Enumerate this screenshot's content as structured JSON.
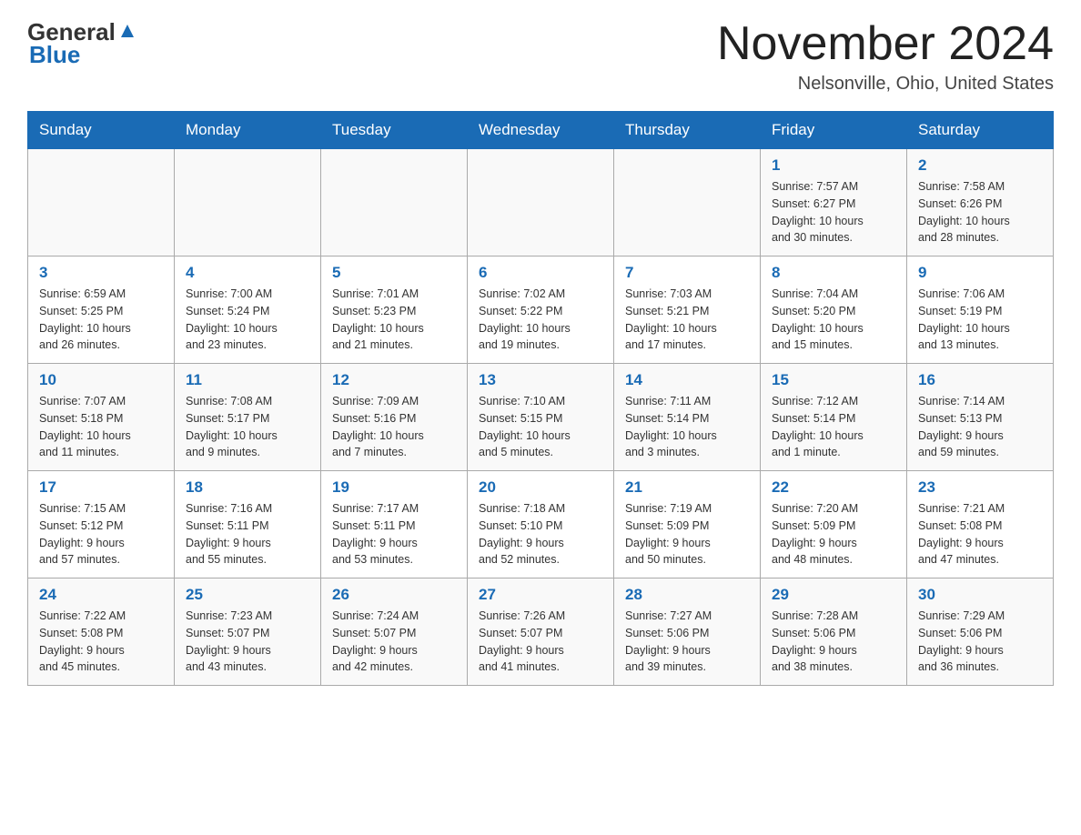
{
  "header": {
    "logo_general": "General",
    "logo_blue": "Blue",
    "month_title": "November 2024",
    "location": "Nelsonville, Ohio, United States"
  },
  "weekdays": [
    "Sunday",
    "Monday",
    "Tuesday",
    "Wednesday",
    "Thursday",
    "Friday",
    "Saturday"
  ],
  "weeks": [
    [
      {
        "day": "",
        "info": ""
      },
      {
        "day": "",
        "info": ""
      },
      {
        "day": "",
        "info": ""
      },
      {
        "day": "",
        "info": ""
      },
      {
        "day": "",
        "info": ""
      },
      {
        "day": "1",
        "info": "Sunrise: 7:57 AM\nSunset: 6:27 PM\nDaylight: 10 hours\nand 30 minutes."
      },
      {
        "day": "2",
        "info": "Sunrise: 7:58 AM\nSunset: 6:26 PM\nDaylight: 10 hours\nand 28 minutes."
      }
    ],
    [
      {
        "day": "3",
        "info": "Sunrise: 6:59 AM\nSunset: 5:25 PM\nDaylight: 10 hours\nand 26 minutes."
      },
      {
        "day": "4",
        "info": "Sunrise: 7:00 AM\nSunset: 5:24 PM\nDaylight: 10 hours\nand 23 minutes."
      },
      {
        "day": "5",
        "info": "Sunrise: 7:01 AM\nSunset: 5:23 PM\nDaylight: 10 hours\nand 21 minutes."
      },
      {
        "day": "6",
        "info": "Sunrise: 7:02 AM\nSunset: 5:22 PM\nDaylight: 10 hours\nand 19 minutes."
      },
      {
        "day": "7",
        "info": "Sunrise: 7:03 AM\nSunset: 5:21 PM\nDaylight: 10 hours\nand 17 minutes."
      },
      {
        "day": "8",
        "info": "Sunrise: 7:04 AM\nSunset: 5:20 PM\nDaylight: 10 hours\nand 15 minutes."
      },
      {
        "day": "9",
        "info": "Sunrise: 7:06 AM\nSunset: 5:19 PM\nDaylight: 10 hours\nand 13 minutes."
      }
    ],
    [
      {
        "day": "10",
        "info": "Sunrise: 7:07 AM\nSunset: 5:18 PM\nDaylight: 10 hours\nand 11 minutes."
      },
      {
        "day": "11",
        "info": "Sunrise: 7:08 AM\nSunset: 5:17 PM\nDaylight: 10 hours\nand 9 minutes."
      },
      {
        "day": "12",
        "info": "Sunrise: 7:09 AM\nSunset: 5:16 PM\nDaylight: 10 hours\nand 7 minutes."
      },
      {
        "day": "13",
        "info": "Sunrise: 7:10 AM\nSunset: 5:15 PM\nDaylight: 10 hours\nand 5 minutes."
      },
      {
        "day": "14",
        "info": "Sunrise: 7:11 AM\nSunset: 5:14 PM\nDaylight: 10 hours\nand 3 minutes."
      },
      {
        "day": "15",
        "info": "Sunrise: 7:12 AM\nSunset: 5:14 PM\nDaylight: 10 hours\nand 1 minute."
      },
      {
        "day": "16",
        "info": "Sunrise: 7:14 AM\nSunset: 5:13 PM\nDaylight: 9 hours\nand 59 minutes."
      }
    ],
    [
      {
        "day": "17",
        "info": "Sunrise: 7:15 AM\nSunset: 5:12 PM\nDaylight: 9 hours\nand 57 minutes."
      },
      {
        "day": "18",
        "info": "Sunrise: 7:16 AM\nSunset: 5:11 PM\nDaylight: 9 hours\nand 55 minutes."
      },
      {
        "day": "19",
        "info": "Sunrise: 7:17 AM\nSunset: 5:11 PM\nDaylight: 9 hours\nand 53 minutes."
      },
      {
        "day": "20",
        "info": "Sunrise: 7:18 AM\nSunset: 5:10 PM\nDaylight: 9 hours\nand 52 minutes."
      },
      {
        "day": "21",
        "info": "Sunrise: 7:19 AM\nSunset: 5:09 PM\nDaylight: 9 hours\nand 50 minutes."
      },
      {
        "day": "22",
        "info": "Sunrise: 7:20 AM\nSunset: 5:09 PM\nDaylight: 9 hours\nand 48 minutes."
      },
      {
        "day": "23",
        "info": "Sunrise: 7:21 AM\nSunset: 5:08 PM\nDaylight: 9 hours\nand 47 minutes."
      }
    ],
    [
      {
        "day": "24",
        "info": "Sunrise: 7:22 AM\nSunset: 5:08 PM\nDaylight: 9 hours\nand 45 minutes."
      },
      {
        "day": "25",
        "info": "Sunrise: 7:23 AM\nSunset: 5:07 PM\nDaylight: 9 hours\nand 43 minutes."
      },
      {
        "day": "26",
        "info": "Sunrise: 7:24 AM\nSunset: 5:07 PM\nDaylight: 9 hours\nand 42 minutes."
      },
      {
        "day": "27",
        "info": "Sunrise: 7:26 AM\nSunset: 5:07 PM\nDaylight: 9 hours\nand 41 minutes."
      },
      {
        "day": "28",
        "info": "Sunrise: 7:27 AM\nSunset: 5:06 PM\nDaylight: 9 hours\nand 39 minutes."
      },
      {
        "day": "29",
        "info": "Sunrise: 7:28 AM\nSunset: 5:06 PM\nDaylight: 9 hours\nand 38 minutes."
      },
      {
        "day": "30",
        "info": "Sunrise: 7:29 AM\nSunset: 5:06 PM\nDaylight: 9 hours\nand 36 minutes."
      }
    ]
  ]
}
